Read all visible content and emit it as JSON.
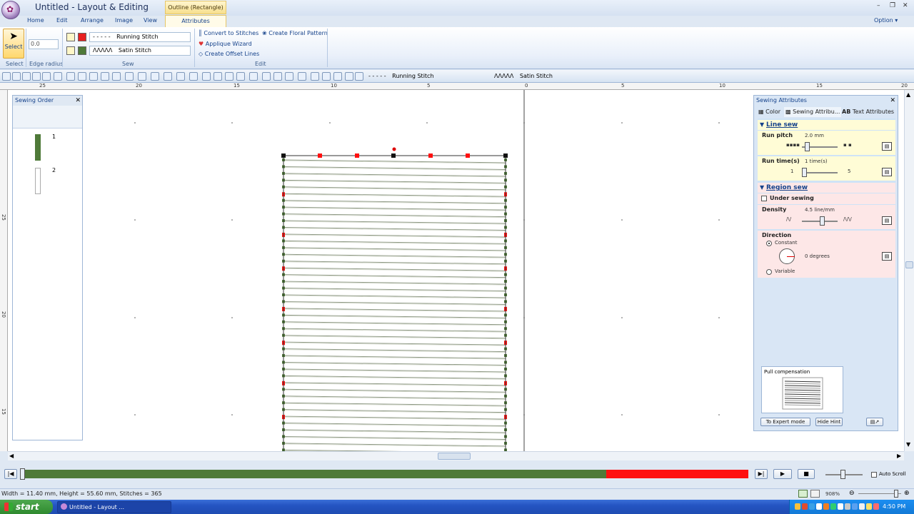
{
  "window": {
    "title": "Untitled - Layout & Editing",
    "context_tab": "Outline (Rectangle)",
    "minimize": "–",
    "restore": "❐",
    "close": "✕"
  },
  "menu": {
    "home": "Home",
    "edit": "Edit",
    "arrange": "Arrange",
    "image": "Image",
    "view": "View",
    "attributes": "Attributes",
    "option": "Option ▾"
  },
  "ribbon": {
    "select": {
      "label": "Select",
      "group": "Select"
    },
    "edge_radius": {
      "value": "0.0",
      "group": "Edge radius"
    },
    "sew": {
      "line_type": "Running Stitch",
      "region_type": "Satin Stitch",
      "group": "Sew"
    },
    "edit": {
      "convert": "Convert to Stitches",
      "floral": "Create Floral Pattern",
      "applique": "Applique Wizard",
      "offset": "Create Offset Lines",
      "group": "Edit"
    }
  },
  "toolbar": {
    "line_type": "Running Stitch",
    "region_type": "Satin Stitch"
  },
  "ruler": {
    "labels": [
      "25",
      "20",
      "15",
      "10",
      "5",
      "0",
      "5",
      "10",
      "15",
      "20"
    ]
  },
  "vruler": {
    "labels": [
      "25",
      "20",
      "15"
    ]
  },
  "sewing_order": {
    "title": "Sewing Order",
    "items": [
      "1",
      "2"
    ],
    "close": "✕"
  },
  "sewing_attributes": {
    "title": "Sewing Attributes",
    "close": "✕",
    "tabs": {
      "color": "Color",
      "sewing": "Sewing Attribu...",
      "text": "Text Attributes"
    },
    "line_sew": {
      "heading": "Line sew",
      "run_pitch": {
        "label": "Run pitch",
        "value": "2.0 mm"
      },
      "run_times": {
        "label": "Run time(s)",
        "value": "1 time(s)",
        "min": "1",
        "max": "5"
      }
    },
    "region_sew": {
      "heading": "Region sew",
      "under_sewing": "Under sewing",
      "density": {
        "label": "Density",
        "value": "4.5 line/mm"
      },
      "direction": {
        "label": "Direction",
        "constant": "Constant",
        "variable": "Variable",
        "degrees": "0 degrees"
      }
    },
    "pull_compensation": "Pull compensation",
    "expert_mode": "To Expert mode",
    "hide_hint": "Hide Hint"
  },
  "playback": {
    "auto_scroll": "Auto Scroll",
    "progress_fraction": 0.805
  },
  "status": {
    "text": "Width = 11.40 mm, Height = 55.60 mm, Stitches = 365",
    "zoom": "908%"
  },
  "taskbar": {
    "start": "start",
    "task": "Untitled - Layout ...",
    "clock": "4:50 PM"
  },
  "colors": {
    "stitch_dark": "#4f7a39",
    "stitch_red": "#ff1010",
    "ribbon_accent": "#15428b"
  }
}
